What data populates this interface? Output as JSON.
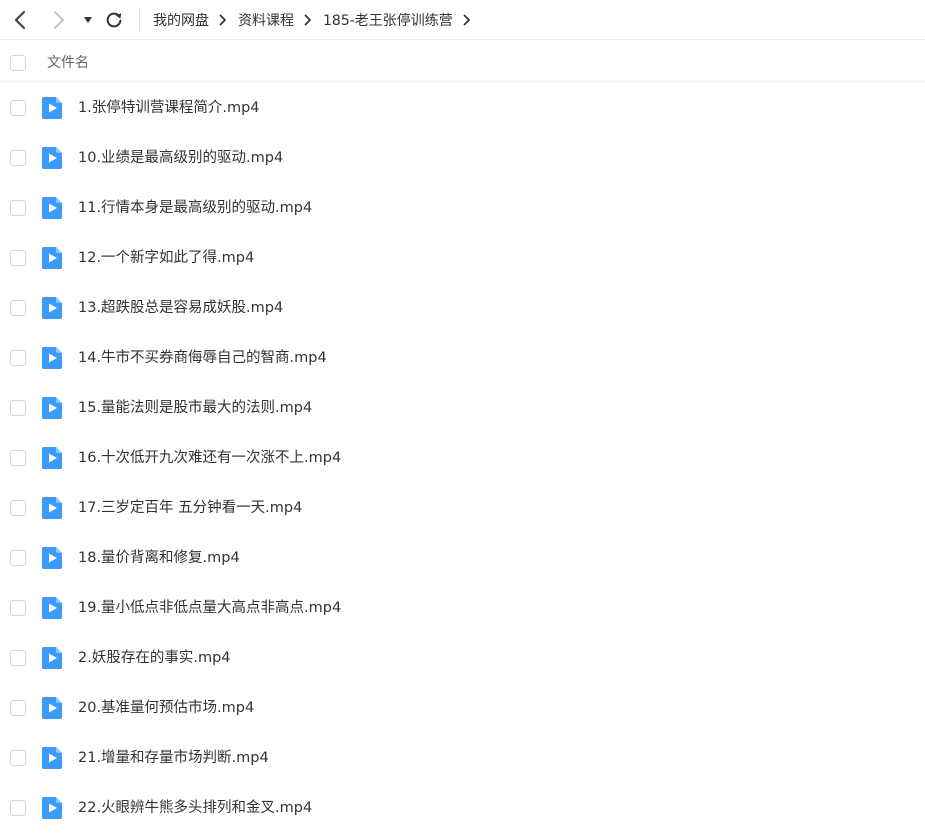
{
  "nav": {
    "back_icon": "chevron-left-icon",
    "forward_icon": "chevron-right-icon",
    "dropdown_icon": "caret-down-icon",
    "refresh_icon": "refresh-icon",
    "separator_icon": "chevron-right-icon"
  },
  "breadcrumb": [
    "我的网盘",
    "资料课程",
    "185-老王张停训练营"
  ],
  "header": {
    "column_label": "文件名"
  },
  "files": [
    {
      "name": "1.张停特训营课程简介.mp4"
    },
    {
      "name": "10.业绩是最高级别的驱动.mp4"
    },
    {
      "name": "11.行情本身是最高级别的驱动.mp4"
    },
    {
      "name": "12.一个新字如此了得.mp4"
    },
    {
      "name": "13.超跌股总是容易成妖股.mp4"
    },
    {
      "name": "14.牛市不买券商侮辱自己的智商.mp4"
    },
    {
      "name": "15.量能法则是股市最大的法则.mp4"
    },
    {
      "name": "16.十次低开九次难还有一次涨不上.mp4"
    },
    {
      "name": "17.三岁定百年 五分钟看一天.mp4"
    },
    {
      "name": "18.量价背离和修复.mp4"
    },
    {
      "name": "19.量小低点非低点量大高点非高点.mp4"
    },
    {
      "name": "2.妖股存在的事实.mp4"
    },
    {
      "name": "20.基准量何预估市场.mp4"
    },
    {
      "name": "21.增量和存量市场判断.mp4"
    },
    {
      "name": "22.火眼辨牛熊多头排列和金叉.mp4"
    }
  ],
  "colors": {
    "video_icon": "#3a9bfc",
    "text": "#333333",
    "divider": "#ececec"
  }
}
